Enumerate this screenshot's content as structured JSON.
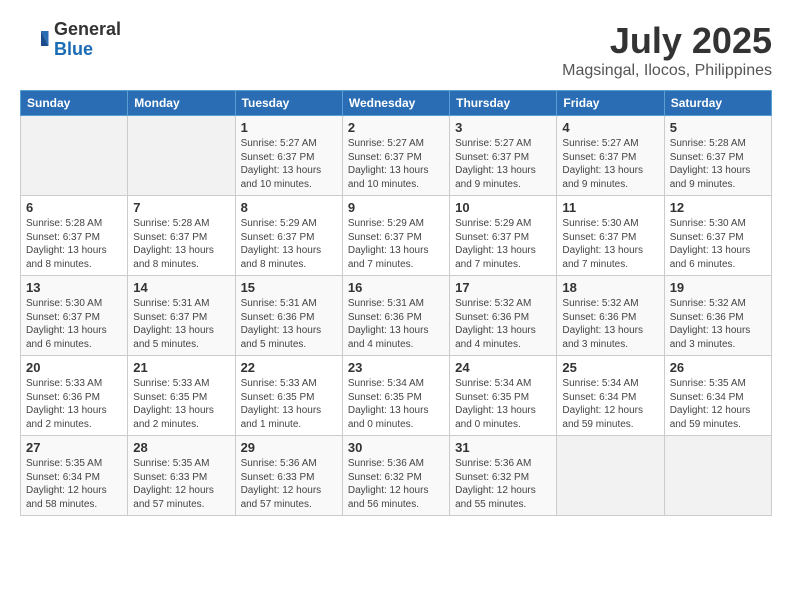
{
  "header": {
    "logo_general": "General",
    "logo_blue": "Blue",
    "month": "July 2025",
    "location": "Magsingal, Ilocos, Philippines"
  },
  "days_of_week": [
    "Sunday",
    "Monday",
    "Tuesday",
    "Wednesday",
    "Thursday",
    "Friday",
    "Saturday"
  ],
  "weeks": [
    [
      {
        "num": "",
        "info": ""
      },
      {
        "num": "",
        "info": ""
      },
      {
        "num": "1",
        "info": "Sunrise: 5:27 AM\nSunset: 6:37 PM\nDaylight: 13 hours\nand 10 minutes."
      },
      {
        "num": "2",
        "info": "Sunrise: 5:27 AM\nSunset: 6:37 PM\nDaylight: 13 hours\nand 10 minutes."
      },
      {
        "num": "3",
        "info": "Sunrise: 5:27 AM\nSunset: 6:37 PM\nDaylight: 13 hours\nand 9 minutes."
      },
      {
        "num": "4",
        "info": "Sunrise: 5:27 AM\nSunset: 6:37 PM\nDaylight: 13 hours\nand 9 minutes."
      },
      {
        "num": "5",
        "info": "Sunrise: 5:28 AM\nSunset: 6:37 PM\nDaylight: 13 hours\nand 9 minutes."
      }
    ],
    [
      {
        "num": "6",
        "info": "Sunrise: 5:28 AM\nSunset: 6:37 PM\nDaylight: 13 hours\nand 8 minutes."
      },
      {
        "num": "7",
        "info": "Sunrise: 5:28 AM\nSunset: 6:37 PM\nDaylight: 13 hours\nand 8 minutes."
      },
      {
        "num": "8",
        "info": "Sunrise: 5:29 AM\nSunset: 6:37 PM\nDaylight: 13 hours\nand 8 minutes."
      },
      {
        "num": "9",
        "info": "Sunrise: 5:29 AM\nSunset: 6:37 PM\nDaylight: 13 hours\nand 7 minutes."
      },
      {
        "num": "10",
        "info": "Sunrise: 5:29 AM\nSunset: 6:37 PM\nDaylight: 13 hours\nand 7 minutes."
      },
      {
        "num": "11",
        "info": "Sunrise: 5:30 AM\nSunset: 6:37 PM\nDaylight: 13 hours\nand 7 minutes."
      },
      {
        "num": "12",
        "info": "Sunrise: 5:30 AM\nSunset: 6:37 PM\nDaylight: 13 hours\nand 6 minutes."
      }
    ],
    [
      {
        "num": "13",
        "info": "Sunrise: 5:30 AM\nSunset: 6:37 PM\nDaylight: 13 hours\nand 6 minutes."
      },
      {
        "num": "14",
        "info": "Sunrise: 5:31 AM\nSunset: 6:37 PM\nDaylight: 13 hours\nand 5 minutes."
      },
      {
        "num": "15",
        "info": "Sunrise: 5:31 AM\nSunset: 6:36 PM\nDaylight: 13 hours\nand 5 minutes."
      },
      {
        "num": "16",
        "info": "Sunrise: 5:31 AM\nSunset: 6:36 PM\nDaylight: 13 hours\nand 4 minutes."
      },
      {
        "num": "17",
        "info": "Sunrise: 5:32 AM\nSunset: 6:36 PM\nDaylight: 13 hours\nand 4 minutes."
      },
      {
        "num": "18",
        "info": "Sunrise: 5:32 AM\nSunset: 6:36 PM\nDaylight: 13 hours\nand 3 minutes."
      },
      {
        "num": "19",
        "info": "Sunrise: 5:32 AM\nSunset: 6:36 PM\nDaylight: 13 hours\nand 3 minutes."
      }
    ],
    [
      {
        "num": "20",
        "info": "Sunrise: 5:33 AM\nSunset: 6:36 PM\nDaylight: 13 hours\nand 2 minutes."
      },
      {
        "num": "21",
        "info": "Sunrise: 5:33 AM\nSunset: 6:35 PM\nDaylight: 13 hours\nand 2 minutes."
      },
      {
        "num": "22",
        "info": "Sunrise: 5:33 AM\nSunset: 6:35 PM\nDaylight: 13 hours\nand 1 minute."
      },
      {
        "num": "23",
        "info": "Sunrise: 5:34 AM\nSunset: 6:35 PM\nDaylight: 13 hours\nand 0 minutes."
      },
      {
        "num": "24",
        "info": "Sunrise: 5:34 AM\nSunset: 6:35 PM\nDaylight: 13 hours\nand 0 minutes."
      },
      {
        "num": "25",
        "info": "Sunrise: 5:34 AM\nSunset: 6:34 PM\nDaylight: 12 hours\nand 59 minutes."
      },
      {
        "num": "26",
        "info": "Sunrise: 5:35 AM\nSunset: 6:34 PM\nDaylight: 12 hours\nand 59 minutes."
      }
    ],
    [
      {
        "num": "27",
        "info": "Sunrise: 5:35 AM\nSunset: 6:34 PM\nDaylight: 12 hours\nand 58 minutes."
      },
      {
        "num": "28",
        "info": "Sunrise: 5:35 AM\nSunset: 6:33 PM\nDaylight: 12 hours\nand 57 minutes."
      },
      {
        "num": "29",
        "info": "Sunrise: 5:36 AM\nSunset: 6:33 PM\nDaylight: 12 hours\nand 57 minutes."
      },
      {
        "num": "30",
        "info": "Sunrise: 5:36 AM\nSunset: 6:32 PM\nDaylight: 12 hours\nand 56 minutes."
      },
      {
        "num": "31",
        "info": "Sunrise: 5:36 AM\nSunset: 6:32 PM\nDaylight: 12 hours\nand 55 minutes."
      },
      {
        "num": "",
        "info": ""
      },
      {
        "num": "",
        "info": ""
      }
    ]
  ]
}
